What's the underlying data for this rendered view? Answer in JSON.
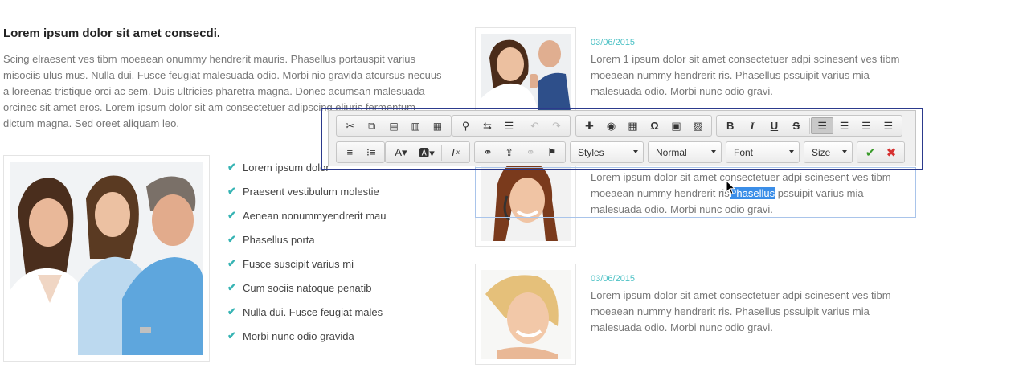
{
  "left": {
    "heading": "Lorem ipsum dolor sit amet consecdi.",
    "paragraph": "Scing elraesent ves tibm moeaean onummy hendrerit mauris. Phasellus portauspit varius misociis ulus mus. Nulla dui. Fusce feugiat malesuada odio. Morbi nio gravida atcursus necuus a loreenas tristique orci ac sem. Duis ultricies pharetra magna. Donec acumsan malesuada orcinec sit amet eros. Lorem ipsum dolor sit am consectetuer adipscing eliuris fermentum dictum magna. Sed oreet aliquam leo.",
    "checklist": [
      "Lorem ipsum dolor",
      "Praesent vestibulum molestie",
      "Aenean nonummyendrerit mau",
      "Phasellus porta",
      "Fusce suscipit varius mi",
      "Cum sociis natoque penatib",
      "Nulla dui. Fusce feugiat males",
      "Morbi nunc odio gravida"
    ]
  },
  "news": [
    {
      "date": "03/06/2015",
      "text": "Lorem 1 ipsum dolor sit amet consectetuer adpi scinesent ves tibm moeaean nummy hendrerit ris. Phasellus pssuipit varius mia malesuada odio. Morbi nunc odio gravi."
    },
    {
      "date": "",
      "text_before": "Lorem ipsum dolor sit amet consectetuer adpi scinesent ves tibm moeaean nummy hendrerit ris",
      "text_selected": "Phasellus",
      "text_after": " pssuipit varius mia malesuada odio. Morbi nunc odio gravi."
    },
    {
      "date": "03/06/2015",
      "text": "Lorem ipsum dolor sit amet consectetuer adpi scinesent ves tibm moeaean nummy hendrerit ris. Phasellus pssuipit varius mia malesuada odio. Morbi nunc odio gravi."
    }
  ],
  "toolbar": {
    "styles_label": "Styles",
    "format_label": "Normal",
    "font_label": "Font",
    "size_label": "Size",
    "icons": {
      "cut": "✂",
      "copy": "⧉",
      "paste": "📋",
      "undo": "↶",
      "redo": "↷",
      "special_char": "Ω",
      "bold": "B",
      "italic": "I",
      "underline": "U",
      "strike": "S",
      "accept": "✔",
      "cancel": "✖"
    },
    "colors": {
      "accept": "#3a9a2a",
      "cancel": "#d63030",
      "accent_border": "#2c3a8c",
      "selection": "#3b8ee8"
    }
  }
}
